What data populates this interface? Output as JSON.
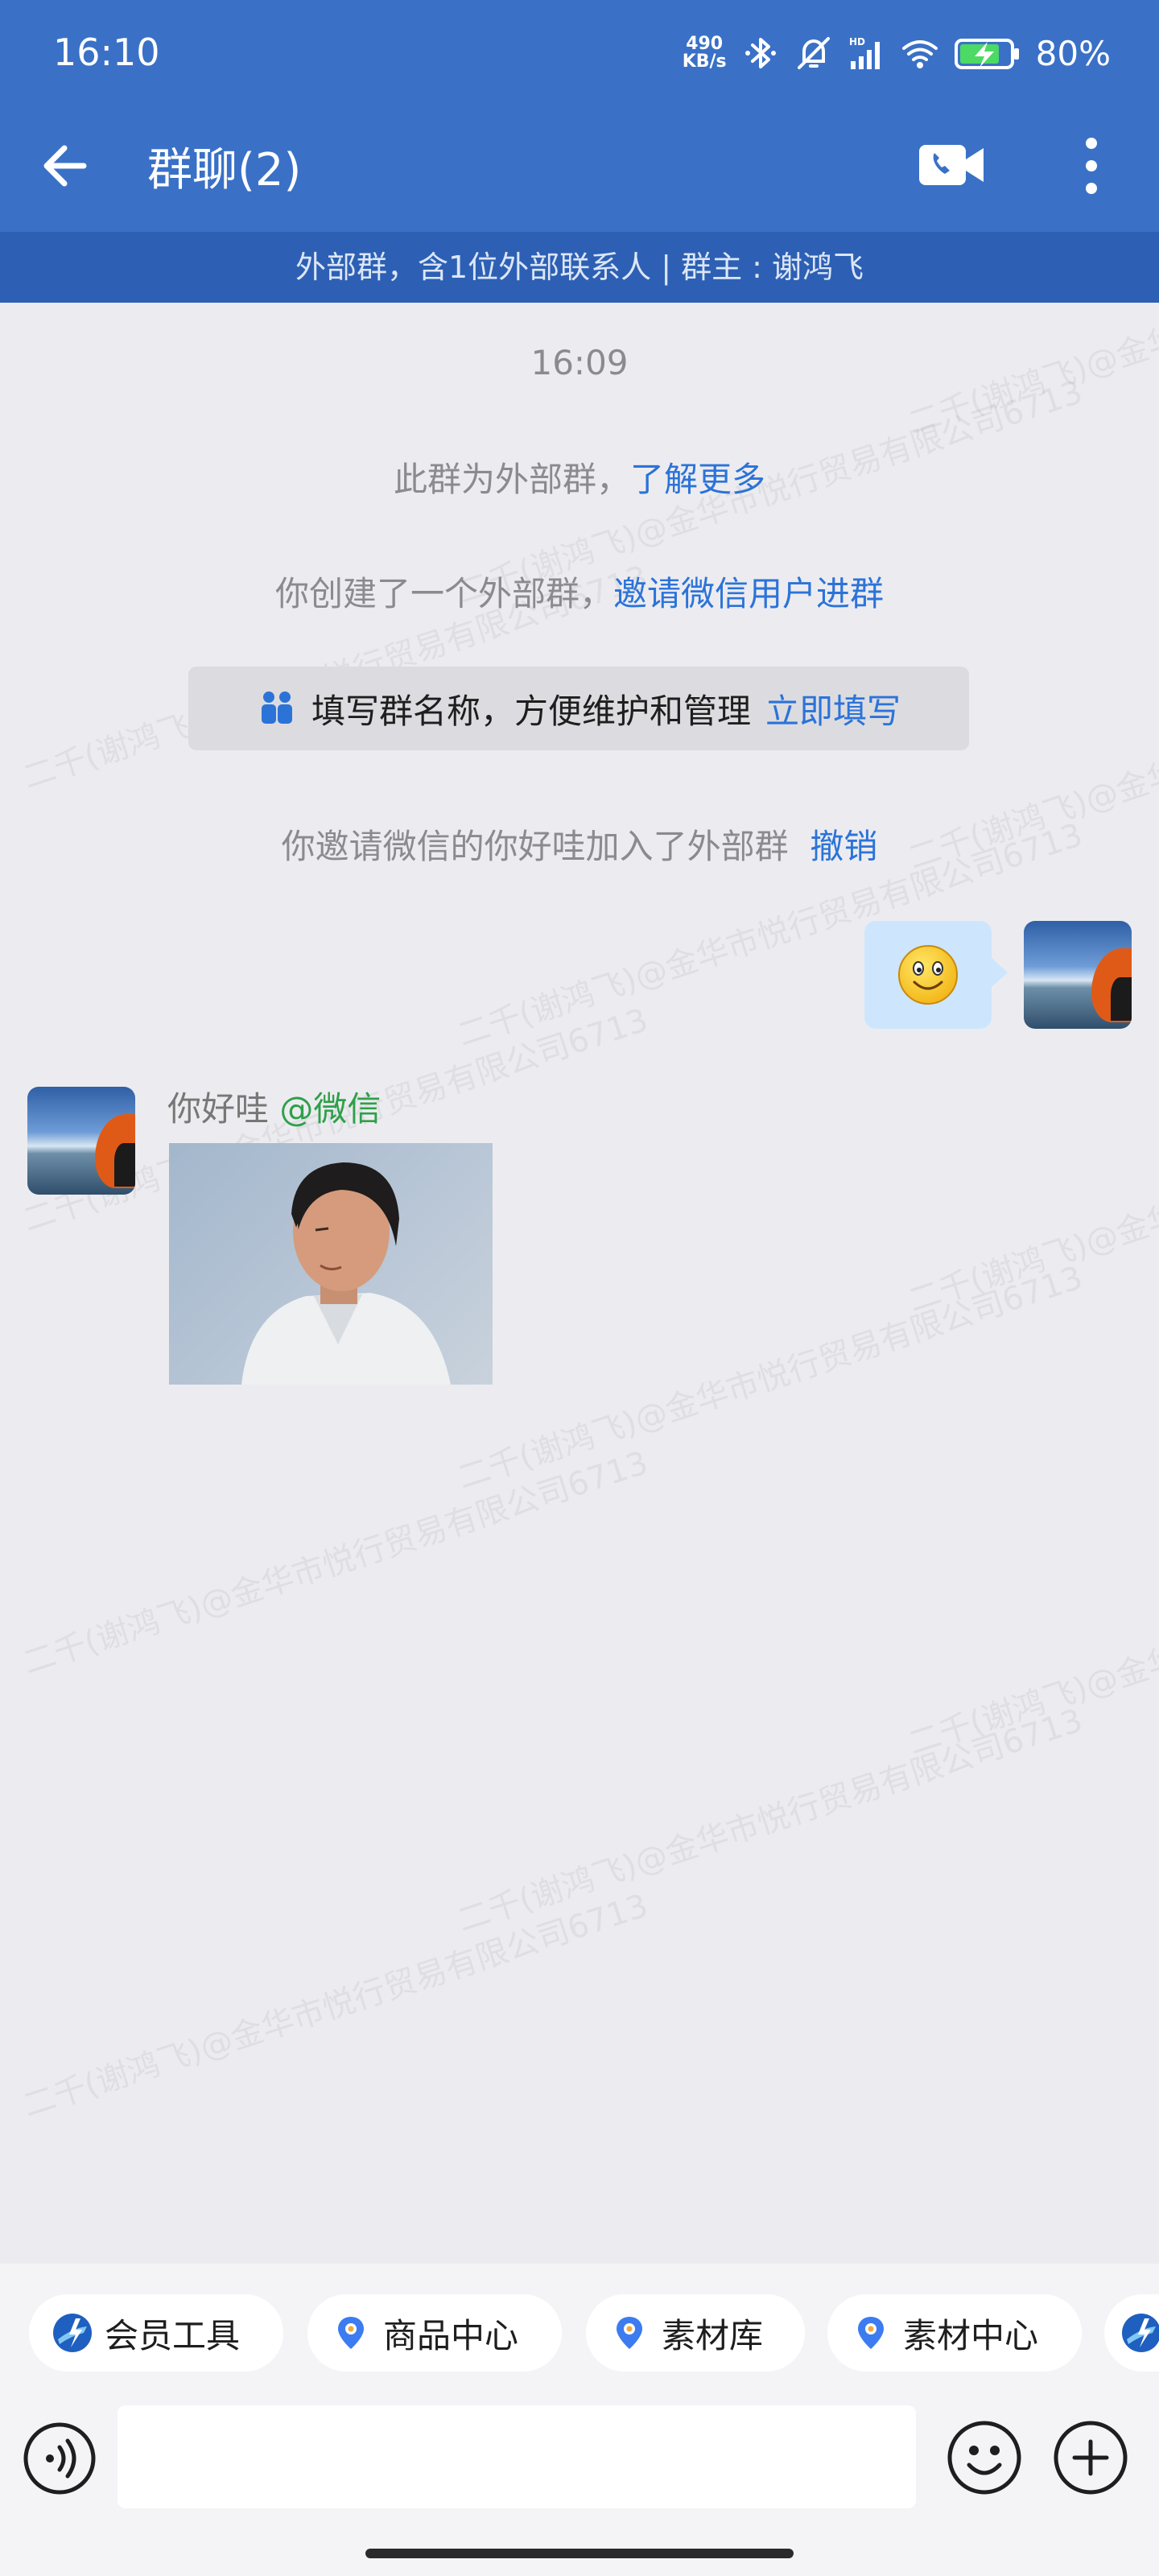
{
  "status_bar": {
    "time": "16:10",
    "network_speed_value": "490",
    "network_speed_unit": "KB/s",
    "battery_percent": "80%",
    "icons": [
      "bluetooth-icon",
      "silent-mode-icon",
      "hd-signal-icon",
      "wifi-icon",
      "battery-charging-icon"
    ]
  },
  "header": {
    "title": "群聊(2)",
    "back_icon": "arrow-left-icon",
    "video_call_icon": "video-call-icon",
    "more_icon": "more-vertical-icon"
  },
  "group_info_bar": "外部群，含1位外部联系人 | 群主 : 谢鸿飞",
  "watermark_text": "二千(谢鸿飞)@金华市悦行贸易有限公司6713",
  "messages": {
    "timestamp": "16:09",
    "external_notice": {
      "text": "此群为外部群，",
      "link": "了解更多"
    },
    "created_notice": {
      "text": "你创建了一个外部群，",
      "link": "邀请微信用户进群"
    },
    "name_tip": {
      "text": "填写群名称，方便维护和管理",
      "link": "立即填写",
      "icon": "people-icon"
    },
    "invite_notice": {
      "text": "你邀请微信的你好哇加入了外部群",
      "link": "撤销"
    },
    "outgoing": {
      "content": "smiley-emoji"
    },
    "incoming": {
      "sender": "你好哇",
      "source_tag": "@微信",
      "content": "photo"
    }
  },
  "quick_actions": [
    {
      "label": "会员工具",
      "icon": "member-tools-icon"
    },
    {
      "label": "商品中心",
      "icon": "location-pin-icon"
    },
    {
      "label": "素材库",
      "icon": "location-pin-icon"
    },
    {
      "label": "素材中心",
      "icon": "location-pin-icon"
    }
  ],
  "input_bar": {
    "value": "",
    "placeholder": "",
    "voice_icon": "voice-input-icon",
    "emoji_icon": "emoji-icon",
    "plus_icon": "plus-icon"
  },
  "colors": {
    "header_bg": "#3A71C7",
    "info_bar_bg": "#2D60B4",
    "chat_bg": "#ECECF0",
    "link": "#2C73D8",
    "outgoing_bubble": "#CDE6FE",
    "source_tag": "#2EA04A"
  }
}
